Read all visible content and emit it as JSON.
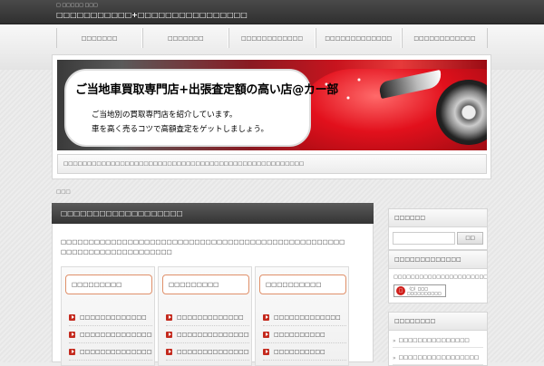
{
  "header": {
    "description": "□ □□□□□ □□□",
    "site_title": "□□□□□□□□□□□+□□□□□□□□□□□□□□□□"
  },
  "nav": {
    "items": [
      {
        "label": "□□□□□□□"
      },
      {
        "label": "□□□□□□□"
      },
      {
        "label": "□□□□□□□□□□□□"
      },
      {
        "label": "□□□□□□□□□□□□□"
      },
      {
        "label": "□□□□□□□□□□□□"
      }
    ]
  },
  "banner": {
    "title": "ご当地車買取専門店+出張査定額の高い店@カー部",
    "line1": "ご当地別の買取専門店を紹介しています。",
    "line2": "車を高く売るコツで高額査定をゲットしましょう。"
  },
  "description_bar": "□□□□□□□□□□□□□□□□□□□□□□□□□□□□□□□□□□□□□□□□□□□□□□□□□□□",
  "breadcrumb": "□□□",
  "content": {
    "title": "□□□□□□□□□□□□□□□□□□□",
    "text_line1": "□□□□□□□□□□□□□□□□□□□□□□□□□□□□□□□□□□□□□□□□□□□□□□□□□□□",
    "text_line2": "□□□□□□□□□□□□□□□□□□□□",
    "categories": [
      {
        "heading": "□□□□□□□□□",
        "items": [
          "□□□□□□□□□□□□□",
          "□□□□□□□□□□□□□□□□□□",
          "□□□□□□□□□□□□□□□□□"
        ]
      },
      {
        "heading": "□□□□□□□□□",
        "items": [
          "□□□□□□□□□□□□□",
          "□□□□□□□□□□□□□□□□□□",
          "□□□□□□□□□□□□□□□□□"
        ]
      },
      {
        "heading": "□□□□□□□□□□",
        "items": [
          "□□□□□□□□□□□□□",
          "□□□□□□□□□□",
          "□□□□□□□□□□"
        ]
      }
    ]
  },
  "sidebar": {
    "search": {
      "title": "□□□□□□",
      "button_label": "□□",
      "placeholder": ""
    },
    "ranking": {
      "title": "□□□□□□□□□□□□□",
      "text": "□□□□□□□□□□□□□□□□□□□□□□□□□□↓",
      "badge_logo": "□",
      "badge_line1": "（□）□□□",
      "badge_line2": "□□□□□□□□□□"
    },
    "recent": {
      "title": "□□□□□□□□",
      "links": [
        "□□□□□□□□□□□□□□□",
        "□□□□□□□□□□□□□□□□□"
      ]
    }
  },
  "colors": {
    "header_dark": "#3a3a3a",
    "accent_red": "#c42a1e",
    "category_border": "#e0906a"
  }
}
